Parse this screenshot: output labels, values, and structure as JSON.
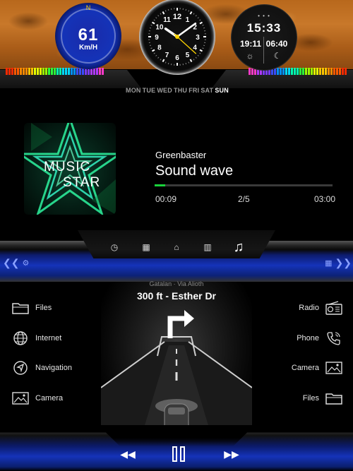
{
  "gauges": {
    "speed": {
      "value": "61",
      "unit": "Km/H",
      "compass": "N"
    },
    "clock": {
      "hour": 10,
      "minute": 9,
      "second": 22
    },
    "digital": {
      "dots": "• • •",
      "time": "15:33",
      "sunrise": "19:11",
      "sunset": "06:40",
      "sun_icon": "sun-icon",
      "moon_icon": "moon-icon"
    }
  },
  "weekdays": {
    "items": [
      "MON",
      "TUE",
      "WED",
      "THU",
      "FRI",
      "SAT",
      "SUN"
    ],
    "active": "SUN"
  },
  "media": {
    "album_line1": "MUSIC",
    "album_line2": "STAR",
    "artist": "Greenbaster",
    "title": "Sound wave",
    "elapsed": "00:09",
    "track_position": "2/5",
    "total": "03:00",
    "progress_fraction": 0.06,
    "progress_color": "#19d23b"
  },
  "nav_bar": {
    "items": [
      {
        "name": "gauge-icon",
        "glyph": "◷"
      },
      {
        "name": "apps-grid-icon",
        "glyph": "▦"
      },
      {
        "name": "home-icon",
        "glyph": "⌂"
      },
      {
        "name": "map-icon",
        "glyph": "▥"
      },
      {
        "name": "music-note-icon",
        "glyph": "♫"
      }
    ]
  },
  "navigation": {
    "previous_street": "Gatalan · Via Alioth",
    "instruction": "300 ft - Esther Dr"
  },
  "shortcuts": {
    "left": [
      {
        "label": "Files",
        "icon": "folder-icon"
      },
      {
        "label": "Internet",
        "icon": "globe-icon"
      },
      {
        "label": "Navigation",
        "icon": "navigation-arrow-icon"
      },
      {
        "label": "Camera",
        "icon": "image-icon"
      }
    ],
    "right": [
      {
        "label": "Radio",
        "icon": "radio-icon"
      },
      {
        "label": "Phone",
        "icon": "phone-icon"
      },
      {
        "label": "Camera",
        "icon": "image-icon"
      },
      {
        "label": "Files",
        "icon": "folder-icon"
      }
    ]
  },
  "playback": {
    "prev_glyph": "◀◀",
    "next_glyph": "▶▶"
  },
  "colors": {
    "accent_blue": "#1533b9",
    "gauge_yellow": "#ffd400",
    "progress_green": "#19d23b"
  }
}
